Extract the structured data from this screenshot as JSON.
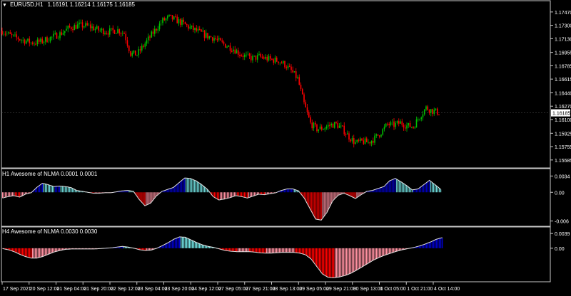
{
  "chart_title": {
    "symbol_timeframe": "EURUSD,H1",
    "ohlc": "1.16191 1.16214 1.16175 1.16185"
  },
  "indicator_h1": {
    "label": "H1 Awesome of NLMA 0.0001 0.0001"
  },
  "indicator_h4": {
    "label": "H4 Awesome of NLMA 0.0030 0.0030"
  },
  "chart_data": [
    {
      "type": "candlestick",
      "title": "EURUSD,H1",
      "price_axis_ticks": [
        "1.17470",
        "1.17300",
        "1.17130",
        "1.16955",
        "1.16785",
        "1.16615",
        "1.16440",
        "1.16270",
        "1.16100",
        "1.15925",
        "1.15755",
        "1.15585"
      ],
      "current_price": "1.16185",
      "ylim": [
        1.1552,
        1.1755
      ],
      "up_color": "#00c000",
      "down_color": "#ff0000",
      "close_path": [
        [
          0,
          1.1723
        ],
        [
          6,
          1.1716
        ],
        [
          12,
          1.1712
        ],
        [
          18,
          1.1708
        ],
        [
          24,
          1.1709
        ],
        [
          30,
          1.1714
        ],
        [
          36,
          1.1719
        ],
        [
          42,
          1.1727
        ],
        [
          48,
          1.173
        ],
        [
          54,
          1.1729
        ],
        [
          60,
          1.1724
        ],
        [
          66,
          1.1722
        ],
        [
          72,
          1.1724
        ],
        [
          76,
          1.172
        ],
        [
          80,
          1.1694
        ],
        [
          84,
          1.1693
        ],
        [
          88,
          1.1704
        ],
        [
          92,
          1.1715
        ],
        [
          96,
          1.1726
        ],
        [
          100,
          1.1736
        ],
        [
          104,
          1.174
        ],
        [
          108,
          1.1737
        ],
        [
          112,
          1.1733
        ],
        [
          116,
          1.1728
        ],
        [
          120,
          1.1724
        ],
        [
          124,
          1.172
        ],
        [
          128,
          1.1716
        ],
        [
          132,
          1.1714
        ],
        [
          136,
          1.1708
        ],
        [
          140,
          1.1704
        ],
        [
          144,
          1.17
        ],
        [
          148,
          1.1694
        ],
        [
          152,
          1.169
        ],
        [
          156,
          1.1688
        ],
        [
          160,
          1.169
        ],
        [
          164,
          1.1688
        ],
        [
          168,
          1.1686
        ],
        [
          172,
          1.1685
        ],
        [
          176,
          1.168
        ],
        [
          180,
          1.1672
        ],
        [
          184,
          1.1662
        ],
        [
          188,
          1.163
        ],
        [
          192,
          1.1605
        ],
        [
          196,
          1.1598
        ],
        [
          200,
          1.1599
        ],
        [
          204,
          1.1603
        ],
        [
          208,
          1.1604
        ],
        [
          212,
          1.1598
        ],
        [
          216,
          1.1588
        ],
        [
          220,
          1.158
        ],
        [
          224,
          1.1582
        ],
        [
          228,
          1.1581
        ],
        [
          232,
          1.1586
        ],
        [
          236,
          1.1594
        ],
        [
          240,
          1.1604
        ],
        [
          244,
          1.1603
        ],
        [
          248,
          1.1606
        ],
        [
          252,
          1.1602
        ],
        [
          256,
          1.1601
        ],
        [
          260,
          1.1614
        ],
        [
          264,
          1.1625
        ],
        [
          268,
          1.1621
        ],
        [
          272,
          1.1619
        ]
      ]
    },
    {
      "type": "histogram",
      "title": "H1 Awesome of NLMA 0.0001 0.0001",
      "axis_ticks": [
        "0.0034",
        "0.00",
        "-0.006"
      ],
      "ylim": [
        -0.0065,
        0.0039
      ],
      "colors": [
        "#0000c8",
        "#70e0e0",
        "#ff0000",
        "#ff90a0"
      ],
      "values": [
        -0.0012,
        -0.0009,
        -0.0007,
        -0.001,
        -0.0004,
        -0.0001,
        0.001,
        0.0019,
        0.0016,
        0.0012,
        0.0013,
        0.0012,
        0.001,
        0.0004,
        0.0002,
        0.0,
        -0.0002,
        -0.0002,
        -0.0001,
        -0.0001,
        0.0001,
        0.0003,
        0.0004,
        0.0002,
        -0.0015,
        -0.0028,
        -0.0023,
        -0.0008,
        0.0002,
        0.0006,
        0.001,
        0.002,
        0.003,
        0.0029,
        0.0024,
        0.0016,
        0.0006,
        -0.0009,
        -0.0016,
        -0.0014,
        -0.0011,
        -0.0007,
        -0.0009,
        -0.0012,
        -0.0008,
        -0.0004,
        -0.0005,
        -0.0003,
        -0.0001,
        0.0004,
        0.0007,
        0.0007,
        0.0003,
        -0.0012,
        -0.0034,
        -0.0056,
        -0.0058,
        -0.0042,
        -0.0018,
        -0.0006,
        -0.0002,
        -0.0007,
        -0.0013,
        -0.0005,
        0.0002,
        0.0004,
        0.0008,
        0.0012,
        0.0024,
        0.0029,
        0.0022,
        0.0014,
        0.0005,
        0.0007,
        0.0016,
        0.0025,
        0.0016,
        0.0006
      ]
    },
    {
      "type": "histogram",
      "title": "H4 Awesome of NLMA 0.0030 0.0030",
      "axis_ticks": [
        "0.0039",
        "0.00"
      ],
      "ylim": [
        -0.0083,
        0.0043
      ],
      "colors": [
        "#0000c8",
        "#70e0e0",
        "#ff0000",
        "#ff90a0"
      ],
      "values": [
        -0.0001,
        -0.0004,
        -0.0009,
        -0.0016,
        -0.0022,
        -0.0026,
        -0.0026,
        -0.0022,
        -0.0016,
        -0.001,
        -0.0006,
        -0.0003,
        -0.0002,
        -0.0002,
        -0.0002,
        -0.0002,
        -0.0002,
        -0.0001,
        0.0,
        0.0001,
        0.0003,
        0.0005,
        0.0003,
        0.0,
        -0.0004,
        -0.0006,
        -0.0005,
        0.0,
        0.0007,
        0.0015,
        0.0024,
        0.003,
        0.0029,
        0.0022,
        0.0015,
        0.0009,
        0.0005,
        0.0002,
        -0.0002,
        -0.0006,
        -0.0008,
        -0.0009,
        -0.0009,
        -0.0009,
        -0.001,
        -0.0012,
        -0.0013,
        -0.0013,
        -0.0012,
        -0.0011,
        -0.0011,
        -0.0011,
        -0.0013,
        -0.0017,
        -0.0028,
        -0.0048,
        -0.0068,
        -0.0077,
        -0.0078,
        -0.0076,
        -0.0072,
        -0.0066,
        -0.0058,
        -0.0049,
        -0.004,
        -0.0031,
        -0.0024,
        -0.0018,
        -0.0013,
        -0.0008,
        -0.0004,
        -0.0001,
        0.0002,
        0.0006,
        0.0011,
        0.0017,
        0.0024,
        0.0028
      ]
    }
  ],
  "time_axis": [
    "17 Sep 2021",
    "20 Sep 12:00",
    "21 Sep 04:00",
    "21 Sep 20:00",
    "22 Sep 12:00",
    "23 Sep 04:00",
    "23 Sep 20:00",
    "24 Sep 12:00",
    "27 Sep 05:00",
    "27 Sep 21:00",
    "28 Sep 13:00",
    "29 Sep 05:00",
    "29 Sep 21:00",
    "30 Sep 13:00",
    "1 Oct 05:00",
    "1 Oct 21:00",
    "4 Oct 14:00"
  ]
}
